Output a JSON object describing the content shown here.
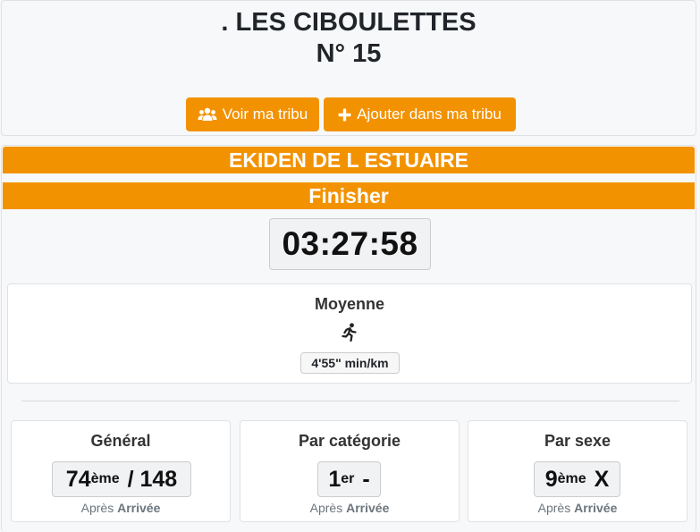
{
  "team": {
    "name": ". LES CIBOULETTES",
    "number": "N° 15"
  },
  "buttons": {
    "view_tribe": "Voir ma tribu",
    "add_tribe": "Ajouter dans ma tribu"
  },
  "race": {
    "name": "EKIDEN DE L ESTUAIRE",
    "status": "Finisher",
    "time": "03:27:58"
  },
  "average": {
    "label": "Moyenne",
    "pace": "4'55\" min/km"
  },
  "rankings": {
    "general": {
      "title": "Général",
      "rank": "74",
      "suffix": "ème",
      "total": " / 148",
      "after_prefix": "Après",
      "after_point": "Arrivée"
    },
    "category": {
      "title": "Par catégorie",
      "rank": "1",
      "suffix": "er",
      "total": " -",
      "after_prefix": "Après",
      "after_point": "Arrivée"
    },
    "sex": {
      "title": "Par sexe",
      "rank": "9",
      "suffix": "ème",
      "total": " X",
      "after_prefix": "Après",
      "after_point": "Arrivée"
    }
  },
  "colors": {
    "accent": "#f39200",
    "text": "#212529",
    "muted": "#6c757d"
  },
  "icons": {
    "view_tribe": "users-icon",
    "add_tribe": "plus-icon",
    "pace": "running-icon"
  }
}
